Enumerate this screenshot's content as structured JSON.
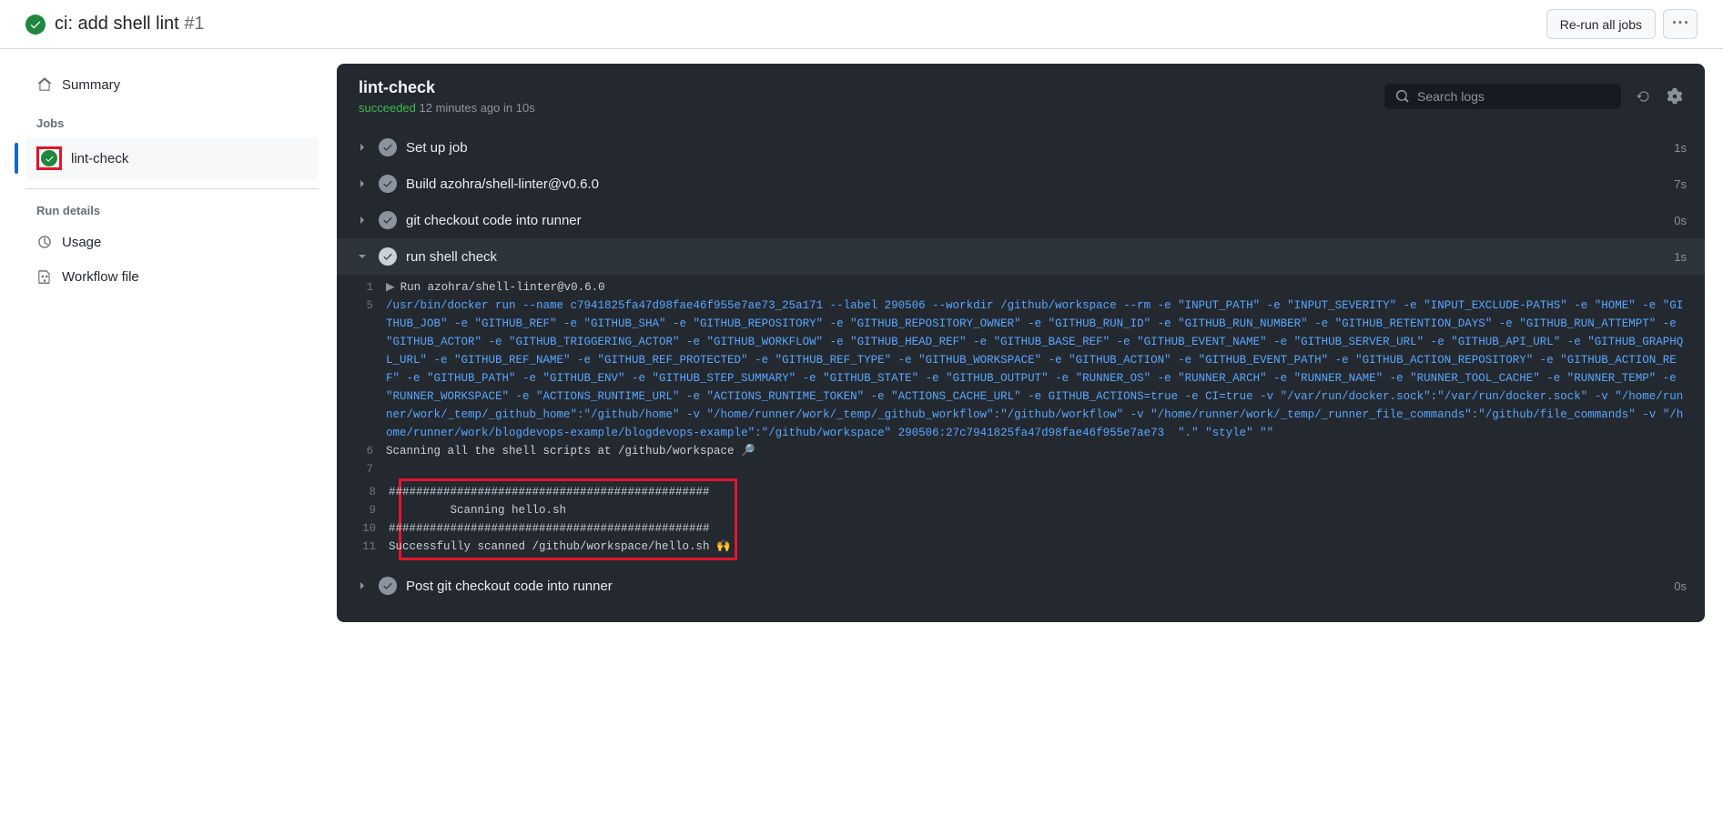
{
  "header": {
    "title": "ci: add shell lint",
    "number": "#1",
    "rerun_label": "Re-run all jobs"
  },
  "sidebar": {
    "summary_label": "Summary",
    "jobs_heading": "Jobs",
    "job_name": "lint-check",
    "rundetails_heading": "Run details",
    "usage_label": "Usage",
    "workflowfile_label": "Workflow file"
  },
  "panel": {
    "title": "lint-check",
    "status_word": "succeeded",
    "status_rest": " 12 minutes ago in 10s",
    "search_placeholder": "Search logs"
  },
  "steps": [
    {
      "name": "Set up job",
      "time": "1s",
      "expanded": false
    },
    {
      "name": "Build azohra/shell-linter@v0.6.0",
      "time": "7s",
      "expanded": false
    },
    {
      "name": "git checkout code into runner",
      "time": "0s",
      "expanded": false
    },
    {
      "name": "run shell check",
      "time": "1s",
      "expanded": true
    },
    {
      "name": "Post git checkout code into runner",
      "time": "0s",
      "expanded": false
    }
  ],
  "log": {
    "l1": "Run azohra/shell-linter@v0.6.0",
    "l5": "/usr/bin/docker run --name c7941825fa47d98fae46f955e7ae73_25a171 --label 290506 --workdir /github/workspace --rm -e \"INPUT_PATH\" -e \"INPUT_SEVERITY\" -e \"INPUT_EXCLUDE-PATHS\" -e \"HOME\" -e \"GITHUB_JOB\" -e \"GITHUB_REF\" -e \"GITHUB_SHA\" -e \"GITHUB_REPOSITORY\" -e \"GITHUB_REPOSITORY_OWNER\" -e \"GITHUB_RUN_ID\" -e \"GITHUB_RUN_NUMBER\" -e \"GITHUB_RETENTION_DAYS\" -e \"GITHUB_RUN_ATTEMPT\" -e \"GITHUB_ACTOR\" -e \"GITHUB_TRIGGERING_ACTOR\" -e \"GITHUB_WORKFLOW\" -e \"GITHUB_HEAD_REF\" -e \"GITHUB_BASE_REF\" -e \"GITHUB_EVENT_NAME\" -e \"GITHUB_SERVER_URL\" -e \"GITHUB_API_URL\" -e \"GITHUB_GRAPHQL_URL\" -e \"GITHUB_REF_NAME\" -e \"GITHUB_REF_PROTECTED\" -e \"GITHUB_REF_TYPE\" -e \"GITHUB_WORKSPACE\" -e \"GITHUB_ACTION\" -e \"GITHUB_EVENT_PATH\" -e \"GITHUB_ACTION_REPOSITORY\" -e \"GITHUB_ACTION_REF\" -e \"GITHUB_PATH\" -e \"GITHUB_ENV\" -e \"GITHUB_STEP_SUMMARY\" -e \"GITHUB_STATE\" -e \"GITHUB_OUTPUT\" -e \"RUNNER_OS\" -e \"RUNNER_ARCH\" -e \"RUNNER_NAME\" -e \"RUNNER_TOOL_CACHE\" -e \"RUNNER_TEMP\" -e \"RUNNER_WORKSPACE\" -e \"ACTIONS_RUNTIME_URL\" -e \"ACTIONS_RUNTIME_TOKEN\" -e \"ACTIONS_CACHE_URL\" -e GITHUB_ACTIONS=true -e CI=true -v \"/var/run/docker.sock\":\"/var/run/docker.sock\" -v \"/home/runner/work/_temp/_github_home\":\"/github/home\" -v \"/home/runner/work/_temp/_github_workflow\":\"/github/workflow\" -v \"/home/runner/work/_temp/_runner_file_commands\":\"/github/file_commands\" -v \"/home/runner/work/blogdevops-example/blogdevops-example\":\"/github/workspace\" 290506:27c7941825fa47d98fae46f955e7ae73  \".\" \"style\" \"\"",
    "l6": "Scanning all the shell scripts at /github/workspace 🔎",
    "l8": "###############################################",
    "l9": "         Scanning hello.sh",
    "l10": "###############################################",
    "l11": "Successfully scanned /github/workspace/hello.sh 🙌"
  }
}
